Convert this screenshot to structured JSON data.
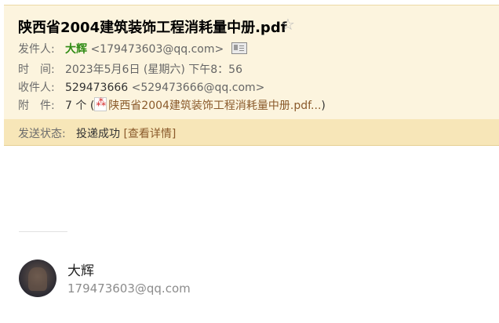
{
  "mail": {
    "subject": "陕西省2004建筑装饰工程消耗量中册.pdf",
    "star_icon": "star-outline-icon",
    "from": {
      "label": "发件人:",
      "name": "大辉",
      "email": "<179473603@qq.com>"
    },
    "time": {
      "label": "时　间:",
      "value": "2023年5月6日 (星期六) 下午8：56"
    },
    "to": {
      "label": "收件人:",
      "name": "529473666",
      "email": "<529473666@qq.com>"
    },
    "attachment": {
      "label": "附　件:",
      "count": "7 个",
      "open": "(",
      "file": "陕西省2004建筑装饰工程消耗量中册.pdf...",
      "close": ")"
    },
    "status": {
      "label": "发送状态:",
      "value": "投递成功",
      "details": "[查看详情]"
    }
  },
  "signature": {
    "name": "大辉",
    "email": "179473603@qq.com"
  },
  "colors": {
    "header_bg": "#fcf4de",
    "status_bg": "#f7e6b8",
    "sender": "#2f8b14",
    "link": "#8a5a2b"
  }
}
